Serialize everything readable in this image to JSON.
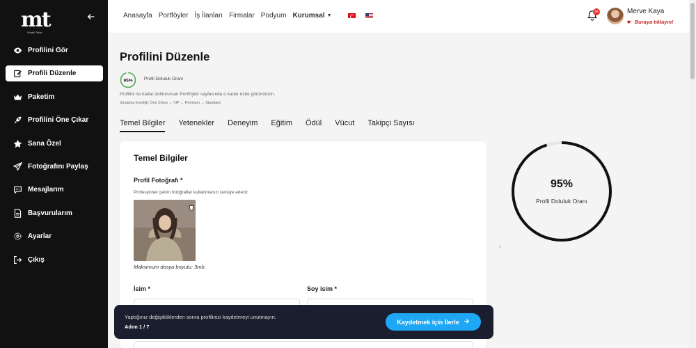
{
  "sidebar": {
    "logo_main": "mt",
    "logo_sub": "Model Talep",
    "items": [
      {
        "label": "Profilini Gör",
        "icon": "eye-icon"
      },
      {
        "label": "Profili Düzenle",
        "icon": "edit-icon"
      },
      {
        "label": "Paketim",
        "icon": "crown-icon"
      },
      {
        "label": "Profilini Öne Çıkar",
        "icon": "rocket-icon"
      },
      {
        "label": "Sana Özel",
        "icon": "star-icon"
      },
      {
        "label": "Fotoğrafını Paylaş",
        "icon": "send-icon"
      },
      {
        "label": "Mesajlarım",
        "icon": "chat-icon"
      },
      {
        "label": "Başvurularım",
        "icon": "document-icon"
      },
      {
        "label": "Ayarlar",
        "icon": "gear-icon"
      },
      {
        "label": "Çıkış",
        "icon": "logout-icon"
      }
    ],
    "active_index": 1
  },
  "topbar": {
    "nav": [
      "Anasayfa",
      "Portföyler",
      "İş İlanları",
      "Firmalar",
      "Podyum"
    ],
    "kurumsal": "Kurumsal",
    "notification_count": "9+",
    "user_name": "Merve Kaya",
    "user_link": "Buraya tıklayın!"
  },
  "main": {
    "title": "Profilini Düzenle",
    "completion_value": 95,
    "completion_pct": "95%",
    "completion_label": "Profil Doluluk Oranı",
    "info": "Profilini ne kadar doldurursan Portföyler sayfasında o kadar üstte görünürsün.",
    "priority": "Sıralama önceliği: Öne Çıkan → VIP → Premium → Standard",
    "tabs": [
      "Temel Bilgiler",
      "Yetenekler",
      "Deneyim",
      "Eğitim",
      "Ödül",
      "Vücut",
      "Takipçi Sayısı"
    ],
    "active_tab": 0
  },
  "card": {
    "title": "Temel Bilgiler",
    "photo_label": "Profil Fotoğrafı *",
    "photo_hint": "Profesyonel çekim fotoğraflar kullanmanızı tavsiye ederiz.",
    "size_note": "Maksimum dosya boyutu: 3mb.",
    "first_name_label": "İsim *",
    "last_name_label": "Soy isim *"
  },
  "toast": {
    "message": "Yaptığınız değişikliklerden sonra profilinizi kaydetmeyi unutmayın.",
    "step": "Adım 1 / 7",
    "button": "Kaydetmek için İlerle"
  },
  "colors": {
    "sidebar_bg": "#111111",
    "accent_blue": "#1ea7f5",
    "ring_green": "#4caf50",
    "toast_bg": "#1b1e2e",
    "link_red": "#c62828"
  }
}
